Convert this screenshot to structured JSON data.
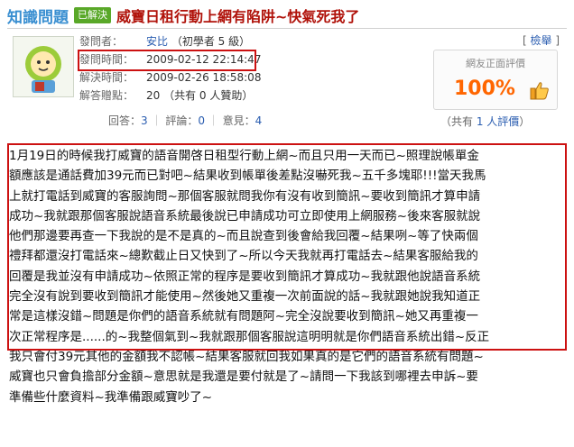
{
  "header": {
    "brand": "知識問題",
    "badge": "已解決",
    "title": "威寶日租行動上網有陷阱~快氣死我了"
  },
  "meta": {
    "asker_label": "發問者：",
    "asker_name": "安比",
    "asker_level": "（初學者 5 級）",
    "ask_time_label": "發問時間：",
    "ask_time": "2009-02-12 22:14:47",
    "solve_time_label": "解決時間：",
    "solve_time": "2009-02-26 18:58:08",
    "reward_label": "解答贈點：",
    "reward_value": "20",
    "reward_extra": "（共有 0 人贊助）"
  },
  "stats": {
    "answers_label": "回答：",
    "answers": "3",
    "comments_label": "評論：",
    "comments": "0",
    "opinions_label": "意見：",
    "opinions": "4"
  },
  "report": {
    "label": "檢舉"
  },
  "rating": {
    "label": "網友正面評價",
    "value": "100%",
    "voters_prefix": "（共有",
    "voters_link": "1 人評價",
    "voters_suffix": "）"
  },
  "body_lines": [
    "1月19日的時候我打威寶的語音開啓日租型行動上網~而且只用一天而已~照理說帳單金",
    "額應該是通話費加39元而已對吧~結果收到帳單後差點沒嚇死我~五千多塊耶!!!當天我馬",
    "上就打電話到威寶的客服詢問~那個客服就問我你有沒有收到簡訊~要收到簡訊才算申請",
    "成功~我就跟那個客服說語音系統最後說已申請成功可立即使用上網服務~後來客服就說",
    "他們那邊要再查一下我說的是不是真的~而且說查到後會給我回覆~結果咧~等了快兩個",
    "禮拜都還沒打電話來~總歎截止日又快到了~所以今天我就再打電話去~結果客服給我的",
    "回覆是我並沒有申請成功~依照正常的程序是要收到簡訊才算成功~我就跟他說語音系統",
    "完全沒有說到要收到簡訊才能使用~然後她又重複一次前面說的話~我就跟她說我知道正",
    "常是這樣沒錯~問題是你們的語音系統就有問題阿~完全沒說要收到簡訊~她又再重複一",
    "次正常程序是......的~我整個氣到~我就跟那個客服說這明明就是你們語音系統出錯~反正",
    "我只會付39元其他的金額我不認帳~結果客服就回我如果真的是它們的語音系統有問題~",
    "威寶也只會負擔部分金額~意思就是我還是要付就是了~請問一下我該到哪裡去申訴~要",
    "準備些什麼資料~我準備跟威寶吵了~"
  ]
}
